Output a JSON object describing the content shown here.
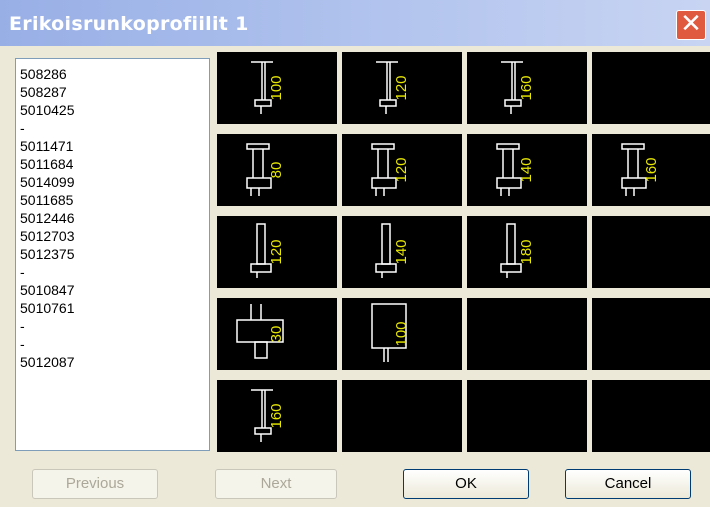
{
  "window": {
    "title": "Erikoisrunkoprofiilit 1",
    "close_label": "✕"
  },
  "list": {
    "items": [
      "508286",
      "508287",
      "5010425",
      "-",
      "5011471",
      "5011684",
      "5014099",
      "5011685",
      "5012446",
      "5012703",
      "5012375",
      "-",
      "5010847",
      "5010761",
      "-",
      "-",
      "5012087"
    ]
  },
  "grid": {
    "rows": [
      [
        {
          "label": "100",
          "shape": "i"
        },
        {
          "label": "120",
          "shape": "i"
        },
        {
          "label": "160",
          "shape": "i"
        },
        {
          "label": "",
          "shape": "none"
        }
      ],
      [
        {
          "label": "80",
          "shape": "ibox"
        },
        {
          "label": "120",
          "shape": "ibox"
        },
        {
          "label": "140",
          "shape": "ibox"
        },
        {
          "label": "160",
          "shape": "ibox"
        }
      ],
      [
        {
          "label": "120",
          "shape": "narrow"
        },
        {
          "label": "140",
          "shape": "narrow"
        },
        {
          "label": "180",
          "shape": "narrow"
        },
        {
          "label": "",
          "shape": "none"
        }
      ],
      [
        {
          "label": "30",
          "shape": "box"
        },
        {
          "label": "100",
          "shape": "rect"
        },
        {
          "label": "",
          "shape": "none"
        },
        {
          "label": "",
          "shape": "none"
        }
      ],
      [
        {
          "label": "160",
          "shape": "i"
        },
        {
          "label": "",
          "shape": "none"
        },
        {
          "label": "",
          "shape": "none"
        },
        {
          "label": "",
          "shape": "none"
        }
      ]
    ]
  },
  "buttons": {
    "previous": "Previous",
    "next": "Next",
    "ok": "OK",
    "cancel": "Cancel"
  },
  "colors": {
    "profile_line": "#ffffff",
    "profile_label": "#e8e800",
    "cell_bg": "#000000"
  }
}
